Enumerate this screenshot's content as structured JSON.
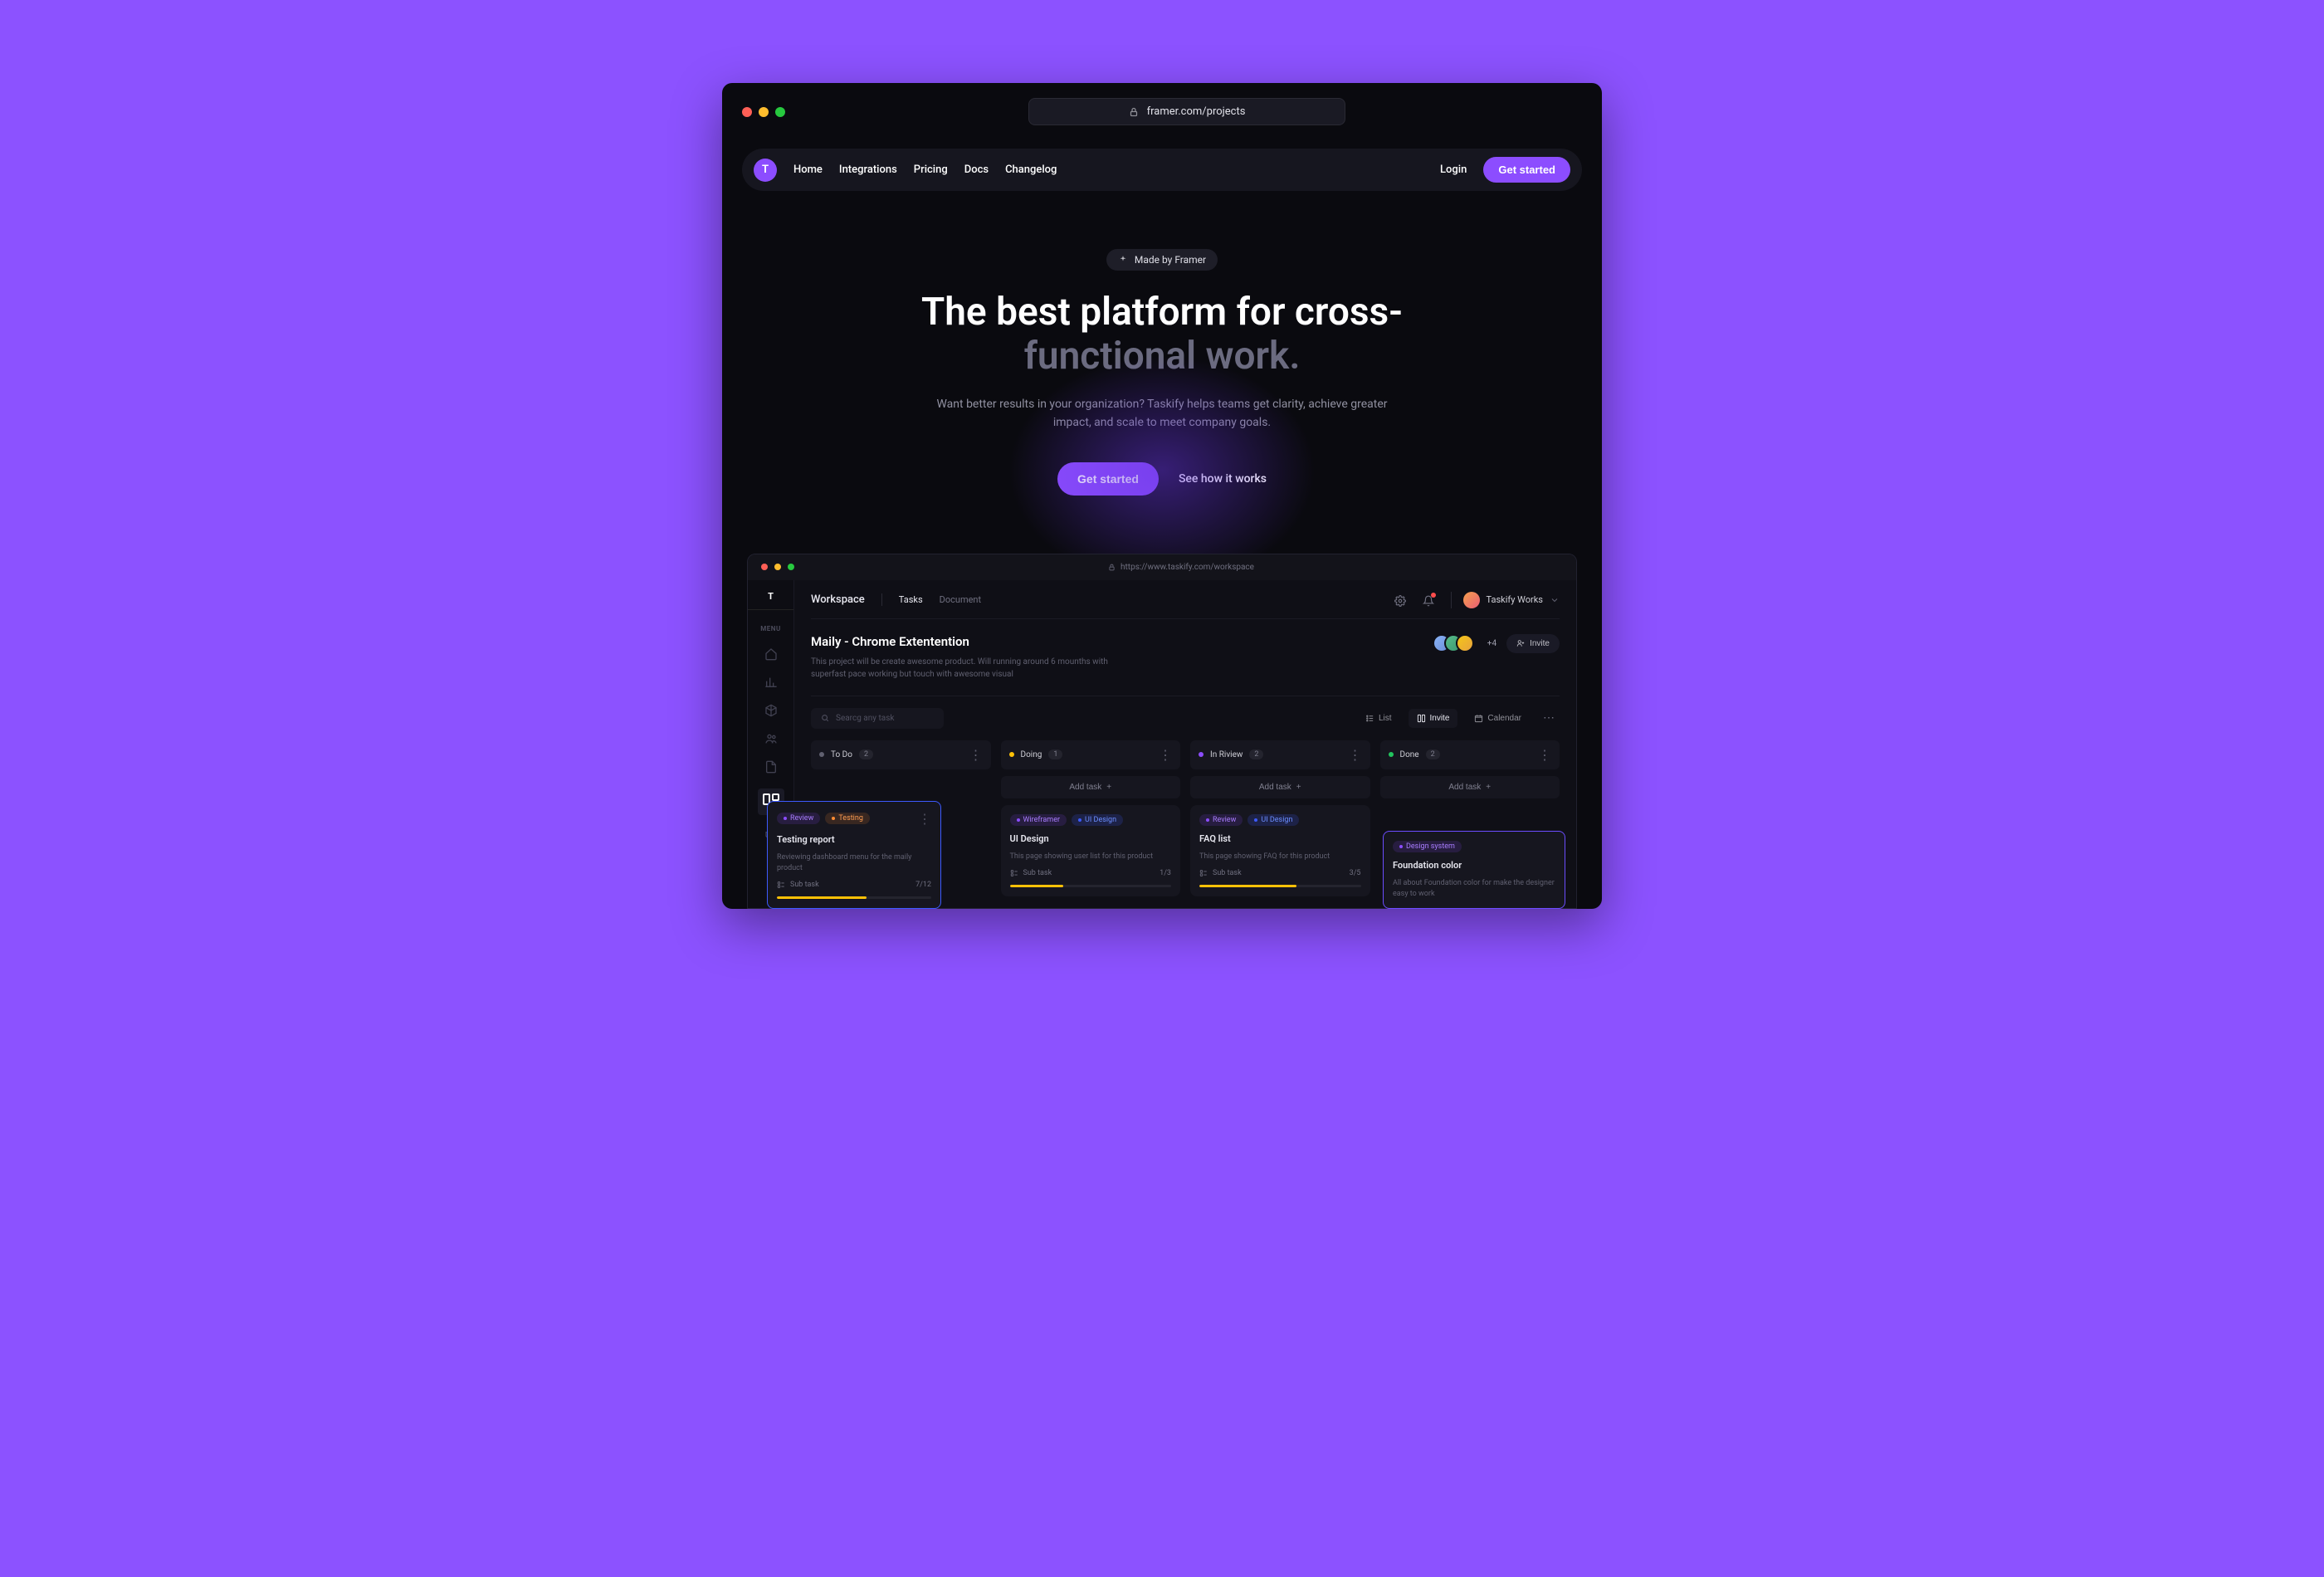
{
  "browser": {
    "url": "framer.com/projects"
  },
  "navbar": {
    "logo_letter": "T",
    "links": [
      "Home",
      "Integrations",
      "Pricing",
      "Docs",
      "Changelog"
    ],
    "login": "Login",
    "cta": "Get started"
  },
  "hero": {
    "badge": "Made by Framer",
    "title_line1": "The best platform for cross-",
    "title_line2": "functional work.",
    "subtitle": "Want better results in your organization? Taskify helps teams get clarity, achieve greater impact, and scale to meet company goals.",
    "primary_cta": "Get started",
    "secondary_cta": "See how it works"
  },
  "inner": {
    "url": "https://www.taskify.com/workspace",
    "sidebar": {
      "logo_letter": "T",
      "menu_label": "MENU"
    },
    "header": {
      "workspace": "Workspace",
      "tabs": [
        "Tasks",
        "Document"
      ],
      "user_name": "Taskify Works"
    },
    "project": {
      "title": "Maily - Chrome Extentention",
      "desc": "This project will be create awesome product. Will running around 6 mounths with superfast pace working but touch with awesome visual",
      "more_count": "+4",
      "invite": "Invite"
    },
    "toolbar": {
      "search_placeholder": "Searcg any task",
      "view_list": "List",
      "view_invite": "Invite",
      "view_calendar": "Calendar"
    },
    "board": {
      "add_task": "Add task",
      "columns": [
        {
          "name": "To Do",
          "count": "2"
        },
        {
          "name": "Doing",
          "count": "1"
        },
        {
          "name": "In Riview",
          "count": "2"
        },
        {
          "name": "Done",
          "count": "2"
        }
      ]
    },
    "cards": {
      "testing_report": {
        "tags": [
          "Review",
          "Testing"
        ],
        "title": "Testing report",
        "desc": "Reviewing dashboard menu for the maily product",
        "subtask_label": "Sub task",
        "progress_text": "7/12",
        "progress_pct": 58
      },
      "ui_design": {
        "tags": [
          "Wireframer",
          "UI Design"
        ],
        "title": "UI Design",
        "desc": "This page showing user list for this product",
        "subtask_label": "Sub task",
        "progress_text": "1/3",
        "progress_pct": 33
      },
      "faq": {
        "tags": [
          "Review",
          "UI Design"
        ],
        "title": "FAQ list",
        "desc": "This page showing FAQ for this product",
        "subtask_label": "Sub task",
        "progress_text": "3/5",
        "progress_pct": 60
      },
      "foundation": {
        "tags": [
          "Design system"
        ],
        "title": "Foundation color",
        "desc": "All about Foundation color for make the designer easy to work"
      }
    }
  },
  "colors": {
    "accent": "#8c4dff",
    "page_bg": "#8c52ff"
  }
}
